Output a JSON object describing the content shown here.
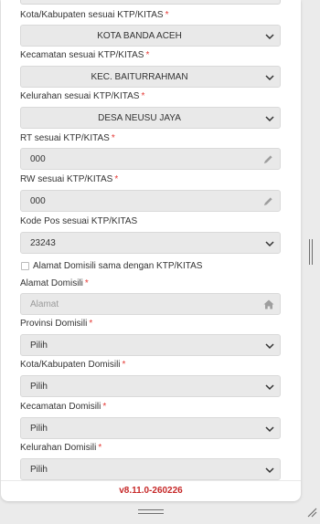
{
  "form": {
    "city_ktp": {
      "label": "Kota/Kabupaten sesuai KTP/KITAS",
      "required": "*",
      "value": "KOTA BANDA ACEH"
    },
    "district_ktp": {
      "label": "Kecamatan sesuai KTP/KITAS",
      "required": "*",
      "value": "KEC. BAITURRAHMAN"
    },
    "village_ktp": {
      "label": "Kelurahan sesuai KTP/KITAS",
      "required": "*",
      "value": "DESA NEUSU JAYA"
    },
    "rt_ktp": {
      "label": "RT sesuai KTP/KITAS",
      "required": "*",
      "value": "000"
    },
    "rw_ktp": {
      "label": "RW sesuai KTP/KITAS",
      "required": "*",
      "value": "000"
    },
    "postal_ktp": {
      "label": "Kode Pos sesuai KTP/KITAS",
      "value": "23243"
    },
    "same_address": {
      "label": "Alamat Domisili sama dengan KTP/KITAS",
      "checked": false
    },
    "address_dom": {
      "label": "Alamat Domisili",
      "required": "*",
      "placeholder": "Alamat"
    },
    "province_dom": {
      "label": "Provinsi Domisili",
      "required": "*",
      "value": "Pilih"
    },
    "city_dom": {
      "label": "Kota/Kabupaten Domisili",
      "required": "*",
      "value": "Pilih"
    },
    "district_dom": {
      "label": "Kecamatan Domisili",
      "required": "*",
      "value": "Pilih"
    },
    "village_dom": {
      "label": "Kelurahan Domisili",
      "required": "*",
      "value": "Pilih"
    }
  },
  "footer": {
    "version": "v8.11.0-260226"
  },
  "icons": {
    "select": "chevron-down-icon",
    "edit": "pencil-icon",
    "address": "home-icon"
  },
  "colors": {
    "required": "#e53935",
    "version": "#c62828",
    "field_bg": "#e9e9e9"
  }
}
